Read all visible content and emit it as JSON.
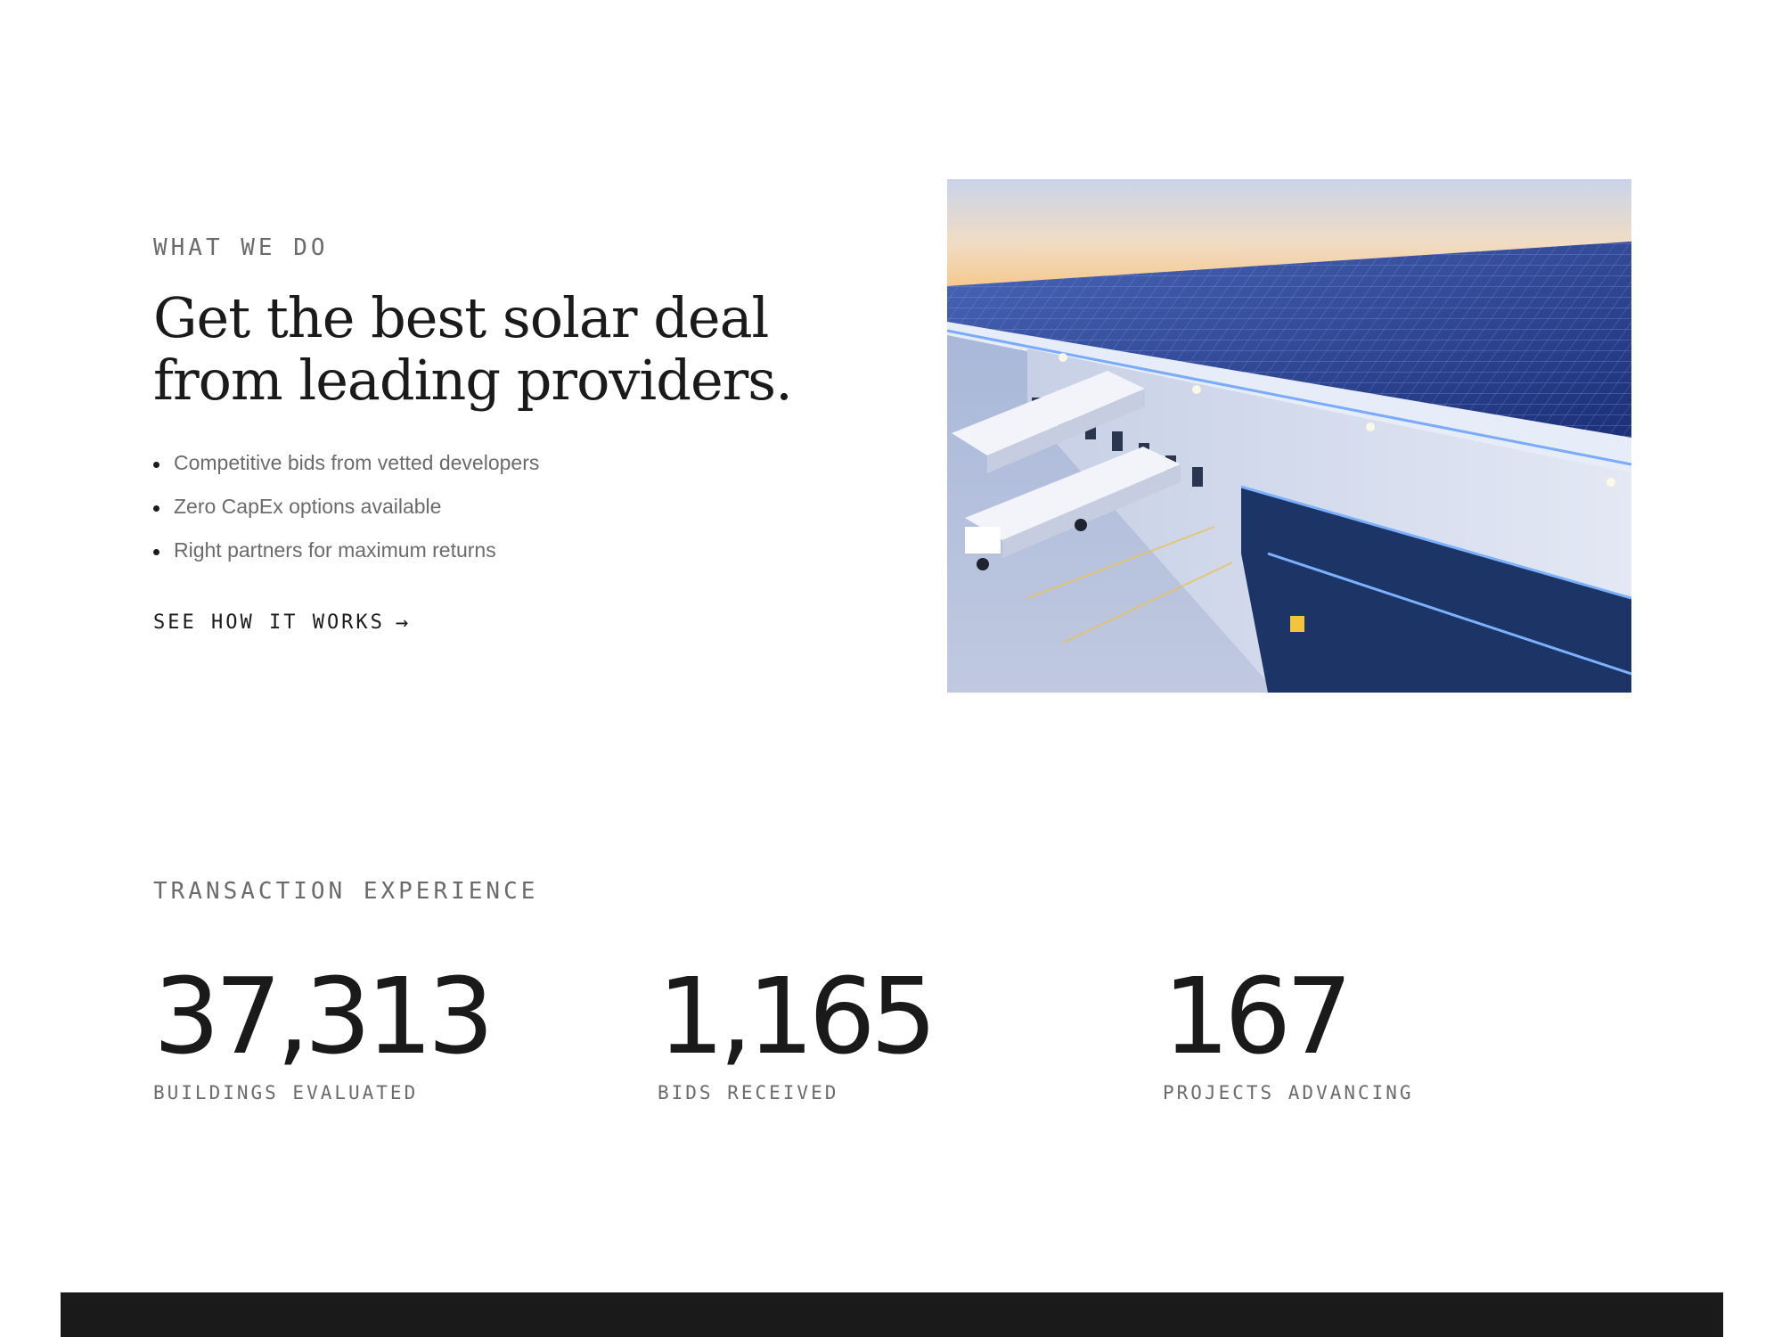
{
  "what_we_do": {
    "eyebrow": "WHAT WE DO",
    "headline_line1": "Get the best solar deal",
    "headline_line2": "from leading providers.",
    "bullets": [
      "Competitive bids from vetted developers",
      "Zero CapEx options available",
      "Right partners for maximum returns"
    ],
    "cta_label": "SEE HOW IT WORKS",
    "cta_arrow": "→",
    "image_subject": "aerial photo of warehouse with rooftop solar panels and trucks at loading docks"
  },
  "transaction_experience": {
    "eyebrow": "TRANSACTION EXPERIENCE",
    "stats": [
      {
        "value": "37,313",
        "label": "BUILDINGS EVALUATED"
      },
      {
        "value": "1,165",
        "label": "BIDS RECEIVED"
      },
      {
        "value": "167",
        "label": "PROJECTS ADVANCING"
      }
    ]
  },
  "colors": {
    "text_primary": "#1a1a1a",
    "text_muted": "#6b6b6b",
    "background": "#ffffff",
    "footer_bar": "#1a1a1a"
  }
}
